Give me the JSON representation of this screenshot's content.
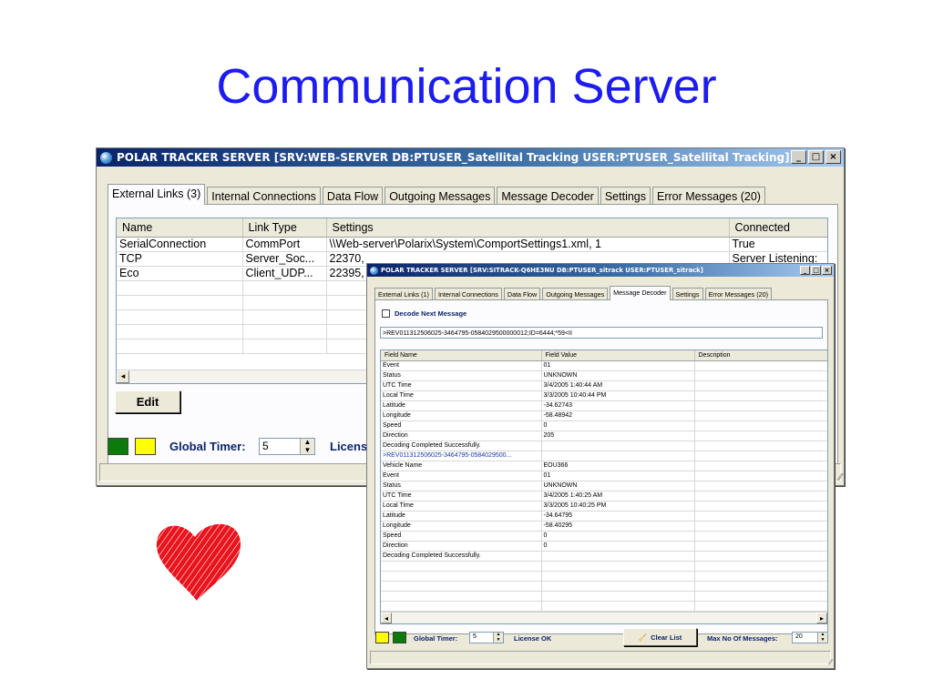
{
  "slide": {
    "title": "Communication Server"
  },
  "main_window": {
    "title": "POLAR TRACKER SERVER [SRV:WEB-SERVER DB:PTUSER_Satellital Tracking USER:PTUSER_Satellital Tracking]",
    "window_buttons": [
      "_",
      "□",
      "×"
    ],
    "tabs": [
      "External Links (3)",
      "Internal Connections",
      "Data Flow",
      "Outgoing Messages",
      "Message Decoder",
      "Settings",
      "Error Messages (20)"
    ],
    "active_tab": 0,
    "grid": {
      "columns": [
        "Name",
        "Link Type",
        "Settings",
        "Connected"
      ],
      "rows": [
        [
          "SerialConnection",
          "CommPort",
          "\\\\Web-server\\Polarix\\System\\ComportSettings1.xml, 1",
          "True"
        ],
        [
          "TCP",
          "Server_Soc...",
          "22370,",
          "Server Listening:"
        ],
        [
          "Eco",
          "Client_UDP...",
          "22395,",
          ""
        ],
        [
          "",
          "",
          "",
          ""
        ],
        [
          "",
          "",
          "",
          ""
        ],
        [
          "",
          "",
          "",
          ""
        ],
        [
          "",
          "",
          "",
          ""
        ],
        [
          "",
          "",
          "",
          ""
        ]
      ],
      "scroll_left_arrow": "◂"
    },
    "edit_button": "Edit",
    "swatch_colors": [
      "#0b7b0b",
      "#ffff00"
    ],
    "global_timer_label": "Global Timer:",
    "global_timer_value": "5",
    "license_label": "Licens",
    "grip": "⁄⁄"
  },
  "popup_window": {
    "title": "POLAR TRACKER SERVER [SRV:SITRACK-Q6HE3NU DB:PTUSER_sitrack USER:PTUSER_sitrack]",
    "window_buttons": [
      "_",
      "□",
      "×"
    ],
    "tabs": [
      "External Links (1)",
      "Internal Connections",
      "Data Flow",
      "Outgoing Messages",
      "Message Decoder",
      "Settings",
      "Error Messages (20)"
    ],
    "active_tab": 4,
    "decode_checkbox": {
      "label": "Decode Next Message",
      "checked": false
    },
    "message_input": ">REV011312506025-3464795-0584029500000012;ID=6444;*59<II",
    "grid": {
      "columns": [
        "Field Name",
        "Field Value",
        "Description"
      ],
      "rows": [
        {
          "name": "Event",
          "value": "01",
          "highlight": false
        },
        {
          "name": "Status",
          "value": "UNKNOWN",
          "highlight": false
        },
        {
          "name": "UTC Time",
          "value": "3/4/2005 1:40:44 AM",
          "highlight": false
        },
        {
          "name": "Local Time",
          "value": "3/3/2005 10:40:44 PM",
          "highlight": false
        },
        {
          "name": "Latitude",
          "value": "-34.62743",
          "highlight": false
        },
        {
          "name": "Longitude",
          "value": "-58.48942",
          "highlight": false
        },
        {
          "name": "Speed",
          "value": "0",
          "highlight": false
        },
        {
          "name": "Direction",
          "value": "205",
          "highlight": false
        },
        {
          "name": "Decoding Completed Successfully.",
          "value": "",
          "highlight": false
        },
        {
          "name": ">REV011312506025-3464795-0584029500...",
          "value": "",
          "highlight": true
        },
        {
          "name": "Vehicle Name",
          "value": "EOU366",
          "highlight": false
        },
        {
          "name": "Event",
          "value": "01",
          "highlight": false
        },
        {
          "name": "Status",
          "value": "UNKNOWN",
          "highlight": false
        },
        {
          "name": "UTC Time",
          "value": "3/4/2005 1:40:25 AM",
          "highlight": false
        },
        {
          "name": "Local Time",
          "value": "3/3/2005 10:40:25 PM",
          "highlight": false
        },
        {
          "name": "Latitude",
          "value": "-34.64795",
          "highlight": false
        },
        {
          "name": "Longitude",
          "value": "-58.40295",
          "highlight": false
        },
        {
          "name": "Speed",
          "value": "0",
          "highlight": false
        },
        {
          "name": "Direction",
          "value": "0",
          "highlight": false
        },
        {
          "name": "Decoding Completed Successfully.",
          "value": "",
          "highlight": false
        },
        {
          "name": "",
          "value": "",
          "highlight": false
        },
        {
          "name": "",
          "value": "",
          "highlight": false
        },
        {
          "name": "",
          "value": "",
          "highlight": false
        },
        {
          "name": "",
          "value": "",
          "highlight": false
        },
        {
          "name": "",
          "value": "",
          "highlight": false
        }
      ],
      "scroll_left_arrow": "◂",
      "scroll_right_arrow": "▸"
    },
    "swatch_colors": [
      "#ffff00",
      "#0b7b0b"
    ],
    "global_timer_label": "Global Timer:",
    "global_timer_value": "5",
    "license_label": "License OK",
    "clear_list_button": "Clear List",
    "max_messages_label": "Max No Of Messages:",
    "max_messages_value": "20",
    "grip": "⁄⁄"
  },
  "heart_color": "#e8141e"
}
